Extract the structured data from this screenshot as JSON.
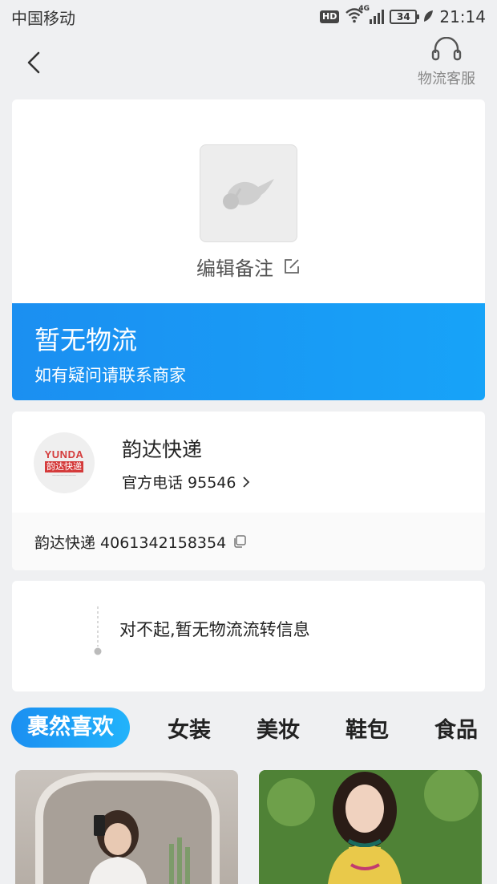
{
  "status_bar": {
    "carrier": "中国移动",
    "hd": "HD",
    "network": "4G",
    "battery": "34",
    "time": "21:14"
  },
  "nav": {
    "back_icon": "chevron-left-icon",
    "service_icon": "headset-icon",
    "service_label": "物流客服"
  },
  "package": {
    "thumb_icon": "bird-placeholder-icon",
    "edit_label": "编辑备注",
    "edit_icon": "edit-icon"
  },
  "status": {
    "title": "暂无物流",
    "subtitle": "如有疑问请联系商家",
    "banner_color": "#1b8ff1"
  },
  "courier": {
    "logo_text_en": "YUNDA",
    "logo_text_cn": "韵达快递",
    "name": "韵达快递",
    "phone_label": "官方电话 95546",
    "tracking": "韵达快递 4061342158354",
    "copy_icon": "copy-icon"
  },
  "trace": {
    "empty_text": "对不起,暂无物流流转信息"
  },
  "tabs": [
    {
      "label": "裹然喜欢",
      "active": true
    },
    {
      "label": "女装",
      "active": false
    },
    {
      "label": "美妆",
      "active": false
    },
    {
      "label": "鞋包",
      "active": false
    },
    {
      "label": "食品",
      "active": false
    }
  ],
  "accent_color": "#1b8ff1"
}
